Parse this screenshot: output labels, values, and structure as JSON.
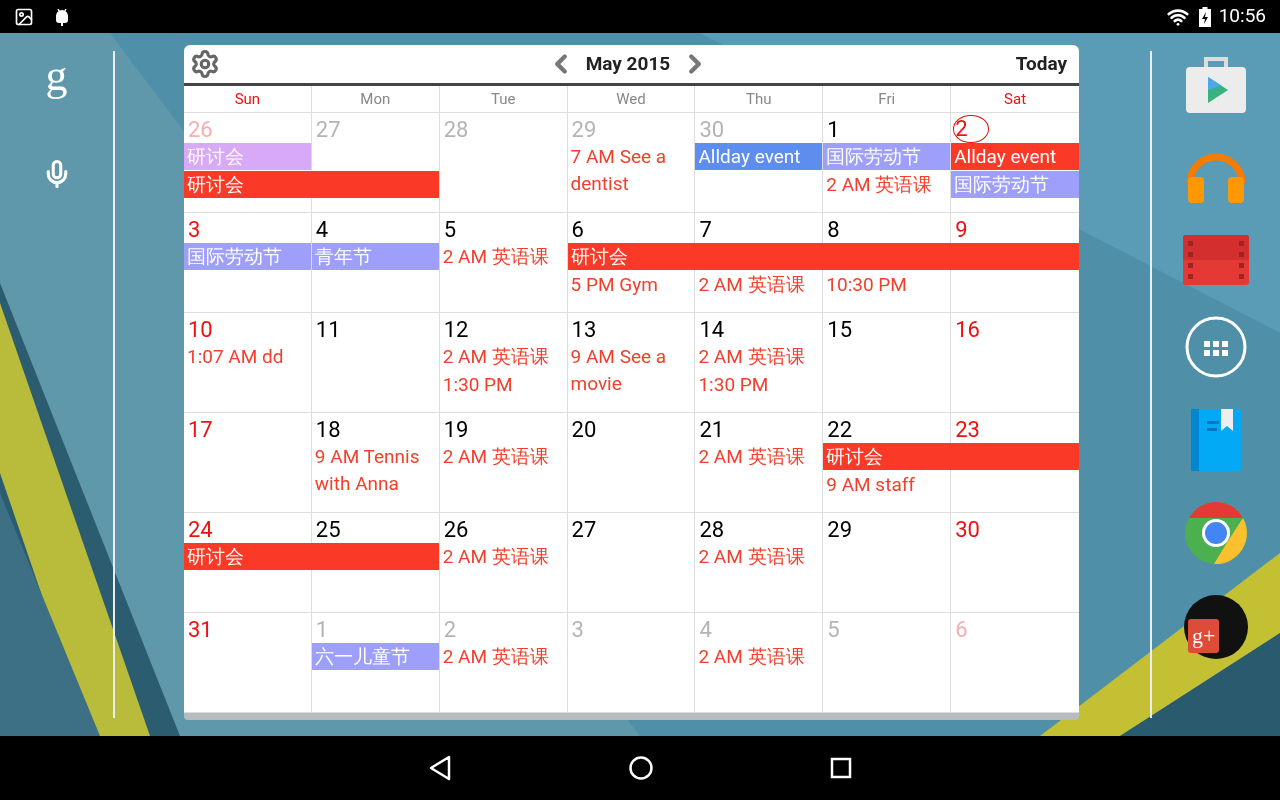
{
  "status_bar": {
    "time": "10:56"
  },
  "home_left": {
    "search_logo": "g"
  },
  "calendar": {
    "title": "May 2015",
    "today_button": "Today",
    "weekdays": [
      "Sun",
      "Mon",
      "Tue",
      "Wed",
      "Thu",
      "Fri",
      "Sat"
    ],
    "weeks": [
      {
        "days": [
          {
            "number": "26",
            "in_month": false,
            "today": false
          },
          {
            "number": "27",
            "in_month": false,
            "today": false
          },
          {
            "number": "28",
            "in_month": false,
            "today": false
          },
          {
            "number": "29",
            "in_month": false,
            "today": false
          },
          {
            "number": "30",
            "in_month": false,
            "today": false
          },
          {
            "number": "1",
            "in_month": true,
            "today": false
          },
          {
            "number": "2",
            "in_month": true,
            "today": true
          }
        ],
        "lanes": [
          [
            {
              "kind": "bar",
              "text": "研讨会",
              "color": "#d8a9f7"
            },
            {
              "kind": "none"
            },
            {
              "kind": "none"
            },
            {
              "kind": "timed",
              "text": "7 AM See a dentist"
            },
            {
              "kind": "bar",
              "text": "Allday event",
              "color": "#5c8def"
            },
            {
              "kind": "bar",
              "text": "国际劳动节",
              "color": "#9d9ffb"
            },
            {
              "kind": "bar",
              "text": "Allday event",
              "color": "#fa3a26"
            }
          ],
          [
            {
              "kind": "bar",
              "text": "研讨会",
              "color": "#fa3a26"
            },
            {
              "kind": "more"
            },
            {
              "kind": "none"
            },
            {
              "kind": "none"
            },
            {
              "kind": "none"
            },
            {
              "kind": "timed",
              "text": "2 AM 英语课"
            },
            {
              "kind": "bar",
              "text": "国际劳动节",
              "color": "#9d9ffb"
            }
          ]
        ]
      },
      {
        "days": [
          {
            "number": "3",
            "in_month": true,
            "today": false
          },
          {
            "number": "4",
            "in_month": true,
            "today": false
          },
          {
            "number": "5",
            "in_month": true,
            "today": false
          },
          {
            "number": "6",
            "in_month": true,
            "today": false
          },
          {
            "number": "7",
            "in_month": true,
            "today": false
          },
          {
            "number": "8",
            "in_month": true,
            "today": false
          },
          {
            "number": "9",
            "in_month": true,
            "today": false
          }
        ],
        "lanes": [
          [
            {
              "kind": "bar",
              "text": "国际劳动节",
              "color": "#9d9ffb"
            },
            {
              "kind": "bar",
              "text": "青年节",
              "color": "#9d9ffb"
            },
            {
              "kind": "timed",
              "text": "2 AM 英语课"
            },
            {
              "kind": "bar",
              "text": "研讨会",
              "color": "#fa3a26"
            },
            {
              "kind": "more"
            },
            {
              "kind": "more"
            },
            {
              "kind": "more"
            }
          ],
          [
            {
              "kind": "none"
            },
            {
              "kind": "none"
            },
            {
              "kind": "none"
            },
            {
              "kind": "timed",
              "text": "5 PM Gym"
            },
            {
              "kind": "timed",
              "text": "2 AM 英语课"
            },
            {
              "kind": "timed",
              "text": "10:30 PM"
            }
          ]
        ]
      },
      {
        "days": [
          {
            "number": "10",
            "in_month": true,
            "today": false
          },
          {
            "number": "11",
            "in_month": true,
            "today": false
          },
          {
            "number": "12",
            "in_month": true,
            "today": false
          },
          {
            "number": "13",
            "in_month": true,
            "today": false
          },
          {
            "number": "14",
            "in_month": true,
            "today": false
          },
          {
            "number": "15",
            "in_month": true,
            "today": false
          },
          {
            "number": "16",
            "in_month": true,
            "today": false
          }
        ],
        "lanes": [
          [
            {
              "kind": "timed",
              "text": "1:07 AM dd"
            },
            {
              "kind": "none"
            },
            {
              "kind": "timed",
              "text": "2 AM 英语课"
            },
            {
              "kind": "timed",
              "text": "9 AM See a movie"
            },
            {
              "kind": "timed",
              "text": "2 AM 英语课"
            }
          ],
          [
            {
              "kind": "none"
            },
            {
              "kind": "none"
            },
            {
              "kind": "timed",
              "text": "1:30 PM"
            },
            {
              "kind": "none"
            },
            {
              "kind": "timed",
              "text": "1:30 PM"
            }
          ]
        ]
      },
      {
        "days": [
          {
            "number": "17",
            "in_month": true,
            "today": false
          },
          {
            "number": "18",
            "in_month": true,
            "today": false
          },
          {
            "number": "19",
            "in_month": true,
            "today": false
          },
          {
            "number": "20",
            "in_month": true,
            "today": false
          },
          {
            "number": "21",
            "in_month": true,
            "today": false
          },
          {
            "number": "22",
            "in_month": true,
            "today": false
          },
          {
            "number": "23",
            "in_month": true,
            "today": false
          }
        ],
        "lanes": [
          [
            {
              "kind": "none"
            },
            {
              "kind": "timed",
              "text": "9 AM Tennis with Anna"
            },
            {
              "kind": "timed",
              "text": "2 AM 英语课"
            },
            {
              "kind": "none"
            },
            {
              "kind": "timed",
              "text": "2 AM 英语课"
            },
            {
              "kind": "bar",
              "text": "研讨会",
              "color": "#fa3a26"
            },
            {
              "kind": "more"
            }
          ],
          [
            {
              "kind": "none"
            },
            {
              "kind": "none"
            },
            {
              "kind": "none"
            },
            {
              "kind": "none"
            },
            {
              "kind": "none"
            },
            {
              "kind": "timed",
              "text": "9 AM staff"
            }
          ]
        ]
      },
      {
        "days": [
          {
            "number": "24",
            "in_month": true,
            "today": false
          },
          {
            "number": "25",
            "in_month": true,
            "today": false
          },
          {
            "number": "26",
            "in_month": true,
            "today": false
          },
          {
            "number": "27",
            "in_month": true,
            "today": false
          },
          {
            "number": "28",
            "in_month": true,
            "today": false
          },
          {
            "number": "29",
            "in_month": true,
            "today": false
          },
          {
            "number": "30",
            "in_month": true,
            "today": false
          }
        ],
        "lanes": [
          [
            {
              "kind": "bar",
              "text": "研讨会",
              "color": "#fa3a26"
            },
            {
              "kind": "more"
            },
            {
              "kind": "timed",
              "text": "2 AM 英语课"
            },
            {
              "kind": "none"
            },
            {
              "kind": "timed",
              "text": "2 AM 英语课"
            }
          ]
        ]
      },
      {
        "days": [
          {
            "number": "31",
            "in_month": true,
            "today": false
          },
          {
            "number": "1",
            "in_month": false,
            "today": false
          },
          {
            "number": "2",
            "in_month": false,
            "today": false
          },
          {
            "number": "3",
            "in_month": false,
            "today": false
          },
          {
            "number": "4",
            "in_month": false,
            "today": false
          },
          {
            "number": "5",
            "in_month": false,
            "today": false
          },
          {
            "number": "6",
            "in_month": false,
            "today": false
          }
        ],
        "lanes": [
          [
            {
              "kind": "none"
            },
            {
              "kind": "bar",
              "text": "六一儿童节",
              "color": "#9d9ffb"
            },
            {
              "kind": "timed",
              "text": "2 AM 英语课"
            },
            {
              "kind": "none"
            },
            {
              "kind": "timed",
              "text": "2 AM 英语课"
            }
          ]
        ]
      }
    ]
  },
  "dock": {
    "social_badge": "g+"
  }
}
